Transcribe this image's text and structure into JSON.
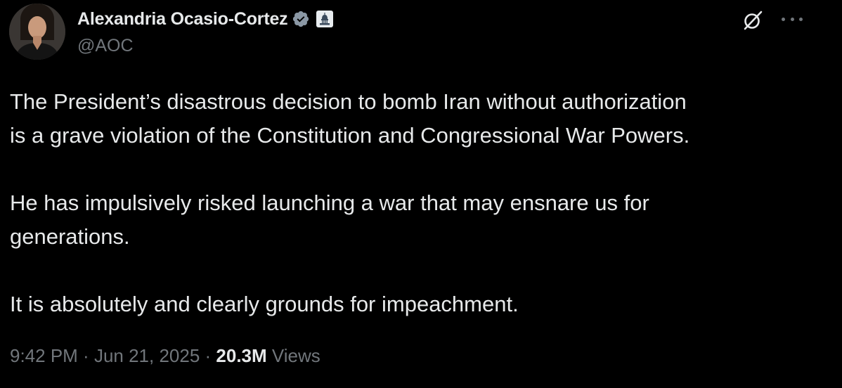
{
  "author": {
    "display_name": "Alexandria Ocasio-Cortez",
    "handle": "@AOC",
    "verified_badge_color": "#8b98a5",
    "gov_badge_icon": "capitol-building-icon"
  },
  "tweet": {
    "paragraphs": [
      {
        "line1": "The President’s disastrous decision to bomb Iran without authorization",
        "line2": "is a grave violation of the Constitution and Congressional War Powers."
      },
      {
        "line1": "He has impulsively risked launching a war that may ensnare us for",
        "line2": "generations."
      },
      {
        "line1": "It is absolutely and clearly grounds for impeachment.",
        "line2": ""
      }
    ]
  },
  "meta": {
    "time": "9:42 PM",
    "separator": " · ",
    "date": "Jun 21, 2025",
    "views_count": "20.3M",
    "views_label": "Views"
  },
  "actions": {
    "grok_icon": "grok-icon",
    "more_icon": "more-horizontal-icon"
  },
  "colors": {
    "background": "#000000",
    "text_primary": "#e7e9ea",
    "text_secondary": "#71767b"
  }
}
